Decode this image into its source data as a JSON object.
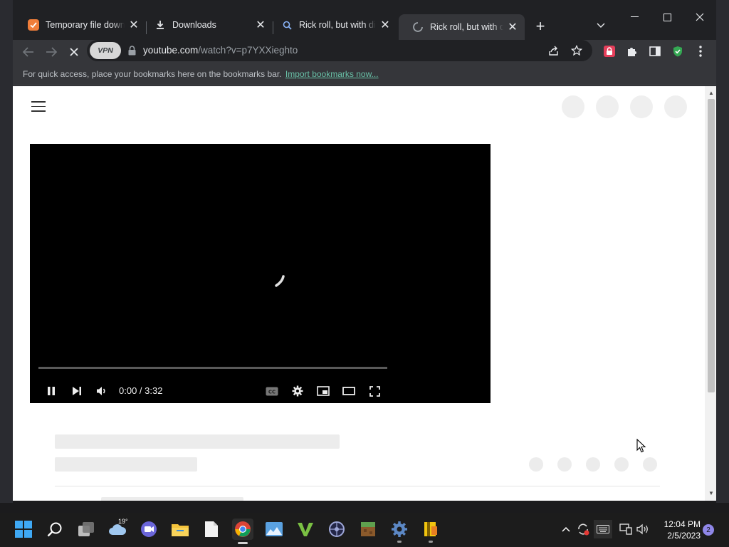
{
  "browser": {
    "tabs": [
      {
        "title": "Temporary file download",
        "icon": "task-checkbox-icon"
      },
      {
        "title": "Downloads",
        "icon": "download-icon"
      },
      {
        "title": "Rick roll, but with different link",
        "icon": "search-icon"
      },
      {
        "title": "Rick roll, but with different link",
        "icon": "loading-spinner-icon",
        "active": true
      }
    ],
    "new_tab_label": "+",
    "address": {
      "vpn_label": "VPN",
      "domain": "youtube.com",
      "path": "/watch?v=p7YXXieghto"
    },
    "bookmarks_bar": {
      "message": "For quick access, place your bookmarks here on the bookmarks bar.",
      "import_link": "Import bookmarks now..."
    },
    "colors": {
      "frame": "#202124",
      "toolbar": "#35363a",
      "link": "#69c2a8"
    }
  },
  "video_player": {
    "time_display": "0:00 / 3:32",
    "state": "buffering",
    "controls": [
      "pause",
      "next",
      "volume",
      "captions",
      "settings",
      "miniplayer",
      "theater",
      "fullscreen"
    ]
  },
  "taskbar": {
    "weather_temp": "19°",
    "clock_time": "12:04 PM",
    "clock_date": "2/5/2023",
    "notification_count": "2",
    "pinned": [
      "start",
      "search",
      "task-view",
      "weather",
      "teams-chat",
      "file-explorer",
      "notepad",
      "chrome",
      "photos",
      "vegas",
      "daemon",
      "minecraft",
      "settings",
      "archive"
    ]
  }
}
